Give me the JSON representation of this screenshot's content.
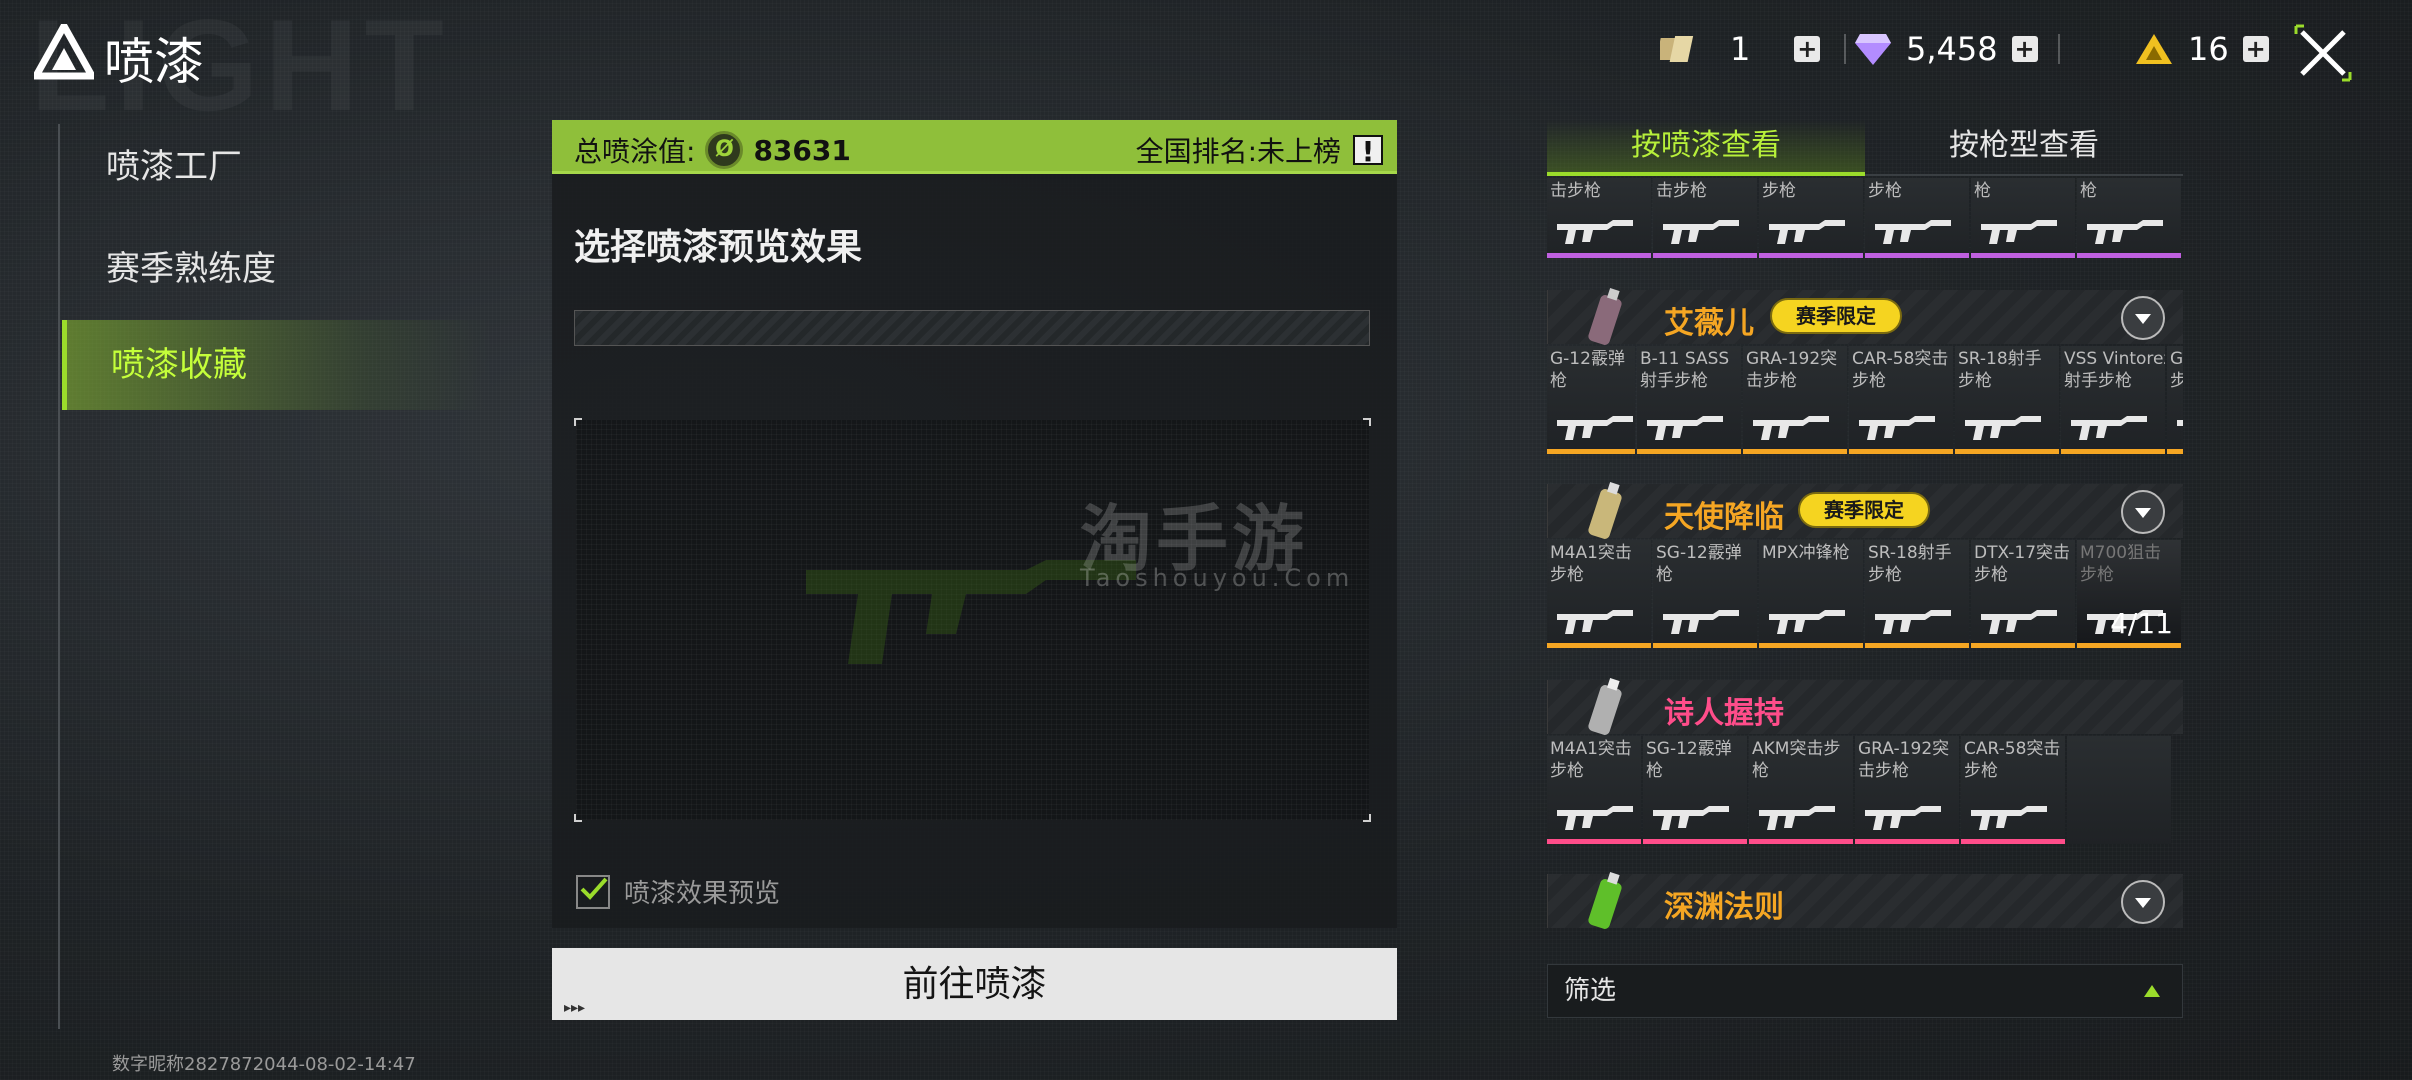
{
  "header": {
    "bg_word": "LIGHT",
    "title": "喷漆",
    "ticket_count": "1",
    "gem_count": "5,458",
    "gold_count": "16",
    "icons": [
      "logo-icon",
      "ticket-icon",
      "diamond-icon",
      "gold-triangle-icon",
      "plus-icon",
      "close-icon"
    ]
  },
  "nav": {
    "items": [
      {
        "label": "喷漆工厂"
      },
      {
        "label": "赛季熟练度"
      },
      {
        "label": "喷漆收藏"
      }
    ],
    "active_index": 2
  },
  "footer": {
    "text": "数字昵称2827872044-08-02-14:47"
  },
  "center": {
    "total_label": "总喷涂值:",
    "total_value": "83631",
    "rank_label": "全国排名:未上榜",
    "section_title": "选择喷漆预览效果",
    "watermark": "淘手游",
    "watermark_sub": "Taoshouyou.Com",
    "checkbox_label": "喷漆效果预览",
    "checkbox_checked": true,
    "go_button": "前往喷漆"
  },
  "right": {
    "tabs": [
      {
        "label": "按喷漆查看"
      },
      {
        "label": "按枪型查看"
      }
    ],
    "active_tab": 0,
    "top_row": [
      {
        "label": "击步枪"
      },
      {
        "label": "击步枪"
      },
      {
        "label": "步枪"
      },
      {
        "label": "步枪"
      },
      {
        "label": "枪"
      },
      {
        "label": "枪"
      }
    ],
    "top_row_color": "#c060e0",
    "sets": [
      {
        "name": "艾薇儿",
        "name_color": "#f5a623",
        "badge": "赛季限定",
        "row_color": "#f5a623",
        "guns": [
          {
            "label": "G-12霰弹\n枪"
          },
          {
            "label": "B-11 SASS\n射手步枪"
          },
          {
            "label": "GRA-192突\n击步枪"
          },
          {
            "label": "CAR-58突击\n步枪"
          },
          {
            "label": "SR-18射手\n步枪"
          },
          {
            "label": "VSS Vintorez\n射手步枪"
          },
          {
            "label": "G\n步"
          }
        ]
      },
      {
        "name": "天使降临",
        "name_color": "#f5a623",
        "badge": "赛季限定",
        "row_color": "#f5a623",
        "count": "4/11",
        "guns": [
          {
            "label": "M4A1突击\n步枪"
          },
          {
            "label": "SG-12霰弹\n枪"
          },
          {
            "label": "MPX冲锋枪"
          },
          {
            "label": "SR-18射手\n步枪"
          },
          {
            "label": "DTX-17突击\n步枪"
          },
          {
            "label": "M700狙击\n步枪"
          }
        ]
      },
      {
        "name": "诗人握持",
        "name_color": "#ff4d8a",
        "row_color": "#ff4d8a",
        "guns": [
          {
            "label": "M4A1突击\n步枪"
          },
          {
            "label": "SG-12霰弹\n枪"
          },
          {
            "label": "AKM突击步\n枪"
          },
          {
            "label": "GRA-192突\n击步枪"
          },
          {
            "label": "CAR-58突击\n步枪"
          }
        ]
      },
      {
        "name": "深渊法则",
        "name_color": "#f5a623"
      }
    ],
    "filter_label": "筛选"
  },
  "colors": {
    "accent": "#9bdc2b",
    "header_green": "#8fbf3a",
    "badge_yellow": "#f5d420"
  }
}
